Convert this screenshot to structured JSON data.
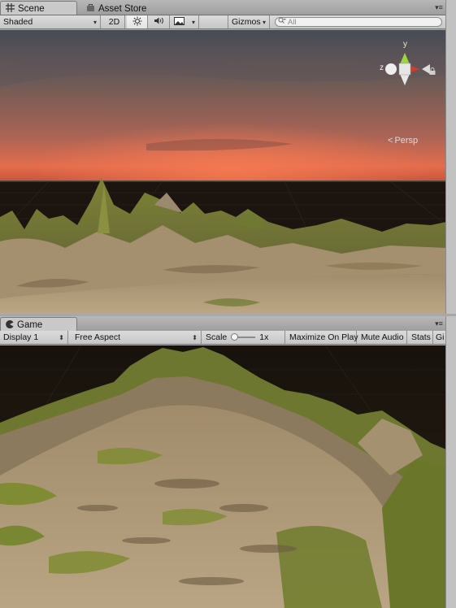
{
  "scene_tab": {
    "label": "Scene"
  },
  "asset_store_tab": {
    "label": "Asset Store"
  },
  "scene_toolbar": {
    "shading_mode": "Shaded",
    "mode_2d": "2D",
    "gizmos": "Gizmos",
    "search_placeholder": "All"
  },
  "gizmo": {
    "y_label": "y",
    "z_label": "z",
    "projection": "Persp"
  },
  "game_tab": {
    "label": "Game"
  },
  "game_toolbar": {
    "display": "Display 1",
    "aspect": "Free Aspect",
    "scale_label": "Scale",
    "scale_value": "1x",
    "maximize_on_play": "Maximize On Play",
    "mute_audio": "Mute Audio",
    "stats": "Stats",
    "gizmos_truncated": "Gi"
  },
  "colors": {
    "sky_top": "#4a4e56",
    "sky_glow": "#e36d4e",
    "ground_dark": "#1c150f",
    "terrain_light": "#b6a07f",
    "grass": "#6f7d2c",
    "toolbar_bg": "#d0d0d0"
  }
}
